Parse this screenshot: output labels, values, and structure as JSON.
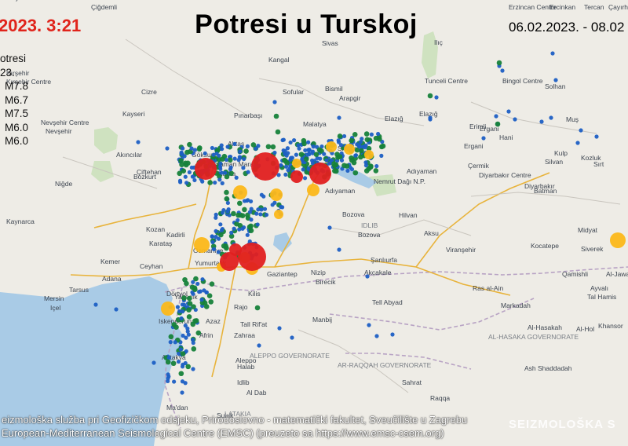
{
  "title": "Potresi u Turskoj",
  "clock": "2023. 3:21",
  "date_range": "06.02.2023. - 08.02",
  "legend": {
    "heading": "otresi",
    "subheading": "23.",
    "items": [
      "M7.8",
      "M6.7",
      "M7.5",
      "M6.0",
      "M6.0"
    ]
  },
  "credits": [
    "eizmološka služba pri Geofizičkom odsjeku, Prirodoslovno - matematički fakultet, Sveučilište u Zagrebu",
    "European-Mediterranean Seismological Centre (EMSC) (preuzeto sa https://www.emsc-csem.org)"
  ],
  "watermark": "SEIZMOLOŠKA S",
  "colors": {
    "water": "#a9cbe6",
    "land": "#eeece6",
    "small": "#1c5fc4",
    "medium": "#16823a",
    "large": "#fbb81a",
    "major": "#e02020",
    "road": "#e8b33b"
  },
  "place_labels": [
    "Çiğdemli",
    "Erzincan Centre",
    "Ercinkan",
    "Tercan",
    "Çayırh",
    "Kırşehir",
    "Kırşehir Centre",
    "Kangal",
    "Sivas",
    "Ilıç",
    "Bingol Centre",
    "Solhan",
    "Kayseri",
    "Sofular",
    "Bismil",
    "Tunceli Centre",
    "Nevşehir Centre",
    "Nevşehir",
    "Akıncılar",
    "Elazığ",
    "Malatya",
    "Ergani",
    "Elazığ",
    "Erimli",
    "Hani",
    "Muş",
    "Niğde",
    "Göksun",
    "Pınarbaşı",
    "Arapgir",
    "Kulp",
    "Ergani",
    "Silvan",
    "Kozluk",
    "Aktaş",
    "Kahraman Maras",
    "Sivrice",
    "Diyarbakır Centre",
    "Çermik",
    "Diyarbakır",
    "Batman",
    "Sırt",
    "Adıyaman",
    "Nemrut Dağı N.P.",
    "Hilvan",
    "Kadirli",
    "Kozan",
    "Bozova",
    "Osmaniye",
    "Midyat",
    "Adana",
    "Ceyhan",
    "Gaziantep",
    "Şanlıurfa",
    "Viranşehir",
    "Kocatepe",
    "Tarsus",
    "Nizip",
    "Birecik",
    "Akçakale",
    "Qamishli",
    "Al-Jawad",
    "Mersin",
    "Içel",
    "Yakacık",
    "Kilis",
    "Ras al-Ain",
    "Tal Hamis",
    "Iskenderun",
    "Rajo",
    "Tell Abyad",
    "Al-Hasakah",
    "Antakya",
    "Afrin",
    "Manbij",
    "Al-Hol",
    "Azaz",
    "Tall Rif'at",
    "AL-HASAKA GOVERNORATE",
    "Khansor",
    "Kahta",
    "Zahraa",
    "Aleppo",
    "AR-RAQQAH GOVERNORATE",
    "Ash Shaddadah",
    "Halab",
    "ALEPPO GOVERNORATE",
    "Raqqa",
    "Dörtyol",
    "Idlib",
    "Al Dab",
    "Sahrat",
    "Markadah",
    "Suluk",
    "Ma'dan",
    "LATAKIA",
    "IDLIB",
    "Bozova",
    "Adıyaman",
    "Aksu",
    "Siverek",
    "Cizre",
    "Bozkurt",
    "Kaynarca",
    "Çiftehan",
    "Kemer",
    "Karataş",
    "Yumurtalık",
    "Ayvalı",
    "Nusaybin"
  ]
}
